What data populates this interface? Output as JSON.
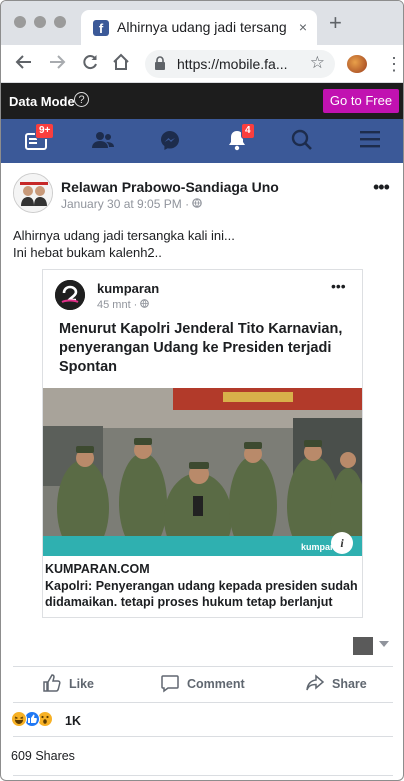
{
  "browser": {
    "tab_title": "Alhirnya udang jadi tersangka",
    "tab_close": "×",
    "new_tab": "+",
    "url": "https://mobile.fa..."
  },
  "data_mode": {
    "label": "Data Mode",
    "help": "?",
    "button": "Go to Free"
  },
  "nav": {
    "home_badge": "9+",
    "notifications_badge": "4"
  },
  "post": {
    "author": "Relawan Prabowo-Sandiaga Uno",
    "timestamp": "January 30 at 9:05 PM · ",
    "text_line1": "Alhirnya udang jadi tersangka kali ini...",
    "text_line2": "Ini hebat bukam kalenh2..",
    "shared": {
      "source_name": "kumparan",
      "source_meta": "45 mnt · ",
      "headline": "Menurut Kapolri Jenderal Tito Karnavian, penyerangan Udang ke Presiden terjadi Spontan",
      "image_watermark": "kumparan",
      "domain": "KUMPARAN.COM",
      "description": "Kapolri: Penyerangan udang kepada presiden sudah didamaikan. tetapi proses hukum tetap berlanjut"
    },
    "actions": {
      "like": "Like",
      "comment": "Comment",
      "share": "Share"
    },
    "reactions_count": "1K",
    "shares_count": "609 Shares"
  }
}
